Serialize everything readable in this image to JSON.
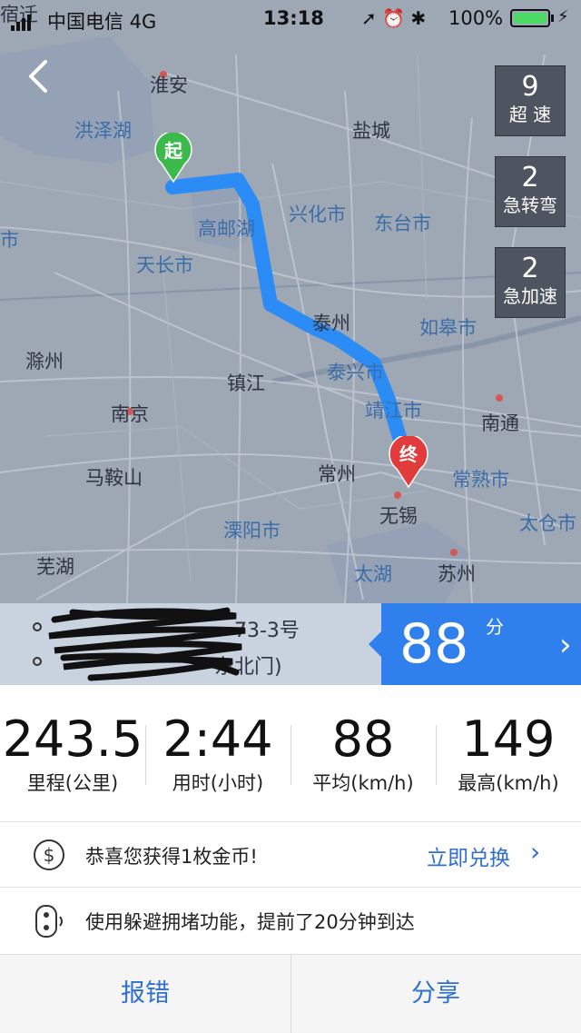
{
  "status_bar": {
    "carrier": "中国电信  4G",
    "time": "13:18",
    "battery": "100%"
  },
  "map": {
    "cities": [
      "淮安",
      "盐城",
      "兴化市",
      "东台市",
      "天长市",
      "泰州",
      "如皋市",
      "滁州",
      "镇江",
      "靖江市",
      "南京",
      "南通",
      "马鞍山",
      "常州",
      "常熟市",
      "无锡",
      "溧阳市",
      "太仓市",
      "芜湖",
      "苏州",
      "宿迁",
      "市",
      "高邮湖",
      "泰兴市"
    ],
    "lakes": [
      "洪泽湖",
      "太湖"
    ],
    "start_label": "起",
    "end_label": "终",
    "route_color": "#2b8cf5"
  },
  "events": [
    {
      "count": "9",
      "label": "超 速"
    },
    {
      "count": "2",
      "label": "急转弯"
    },
    {
      "count": "2",
      "label": "急加速"
    }
  ],
  "route": {
    "from_visible": "73-3号",
    "to_visible": "东北门)"
  },
  "score": {
    "value": "88",
    "unit": "分"
  },
  "stats": [
    {
      "value": "243.5",
      "label": "里程(公里)"
    },
    {
      "value": "2:44",
      "label": "用时(小时)"
    },
    {
      "value": "88",
      "label": "平均(km/h)"
    },
    {
      "value": "149",
      "label": "最高(km/h)"
    }
  ],
  "coin_row": {
    "text": "恭喜您获得1枚金币!",
    "action": "立即兑换"
  },
  "traffic_row": {
    "text": "使用躲避拥堵功能，提前了20分钟到达"
  },
  "buttons": {
    "report": "报错",
    "share": "分享"
  }
}
